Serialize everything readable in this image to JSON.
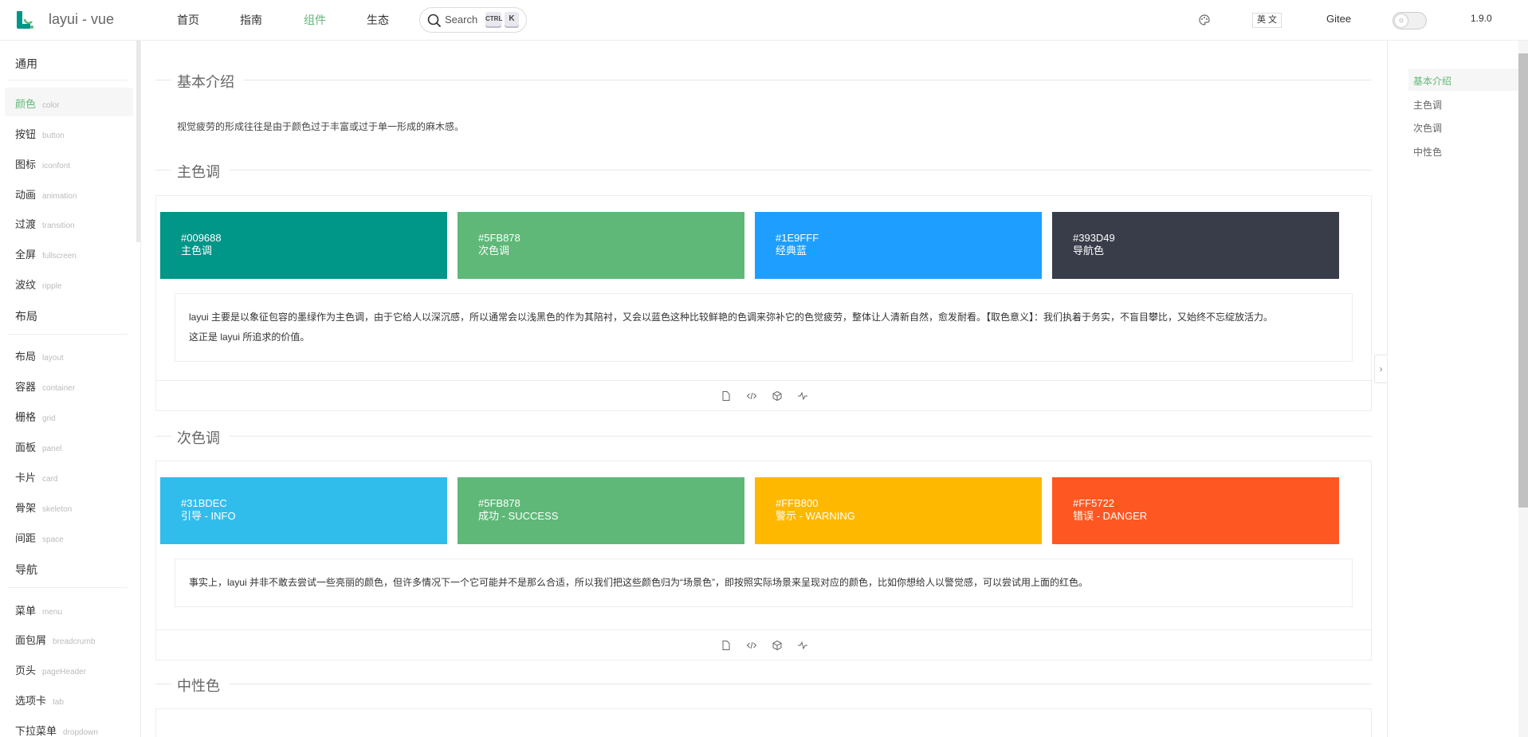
{
  "header": {
    "brand": "layui - vue",
    "nav": [
      "首页",
      "指南",
      "组件",
      "生态"
    ],
    "active_nav": "组件",
    "search_label": "Search",
    "kbd_ctrl": "CTRL",
    "kbd_k": "K",
    "lang": "英 文",
    "gitee": "Gitee",
    "version": "1.9.0"
  },
  "sidebar": {
    "sections": [
      {
        "title": "通用",
        "items": [
          {
            "cn": "颜色",
            "en": "color",
            "active": true
          },
          {
            "cn": "按钮",
            "en": "button"
          },
          {
            "cn": "图标",
            "en": "iconfont"
          },
          {
            "cn": "动画",
            "en": "animation"
          },
          {
            "cn": "过渡",
            "en": "transition"
          },
          {
            "cn": "全屏",
            "en": "fullscreen"
          },
          {
            "cn": "波纹",
            "en": "ripple"
          }
        ]
      },
      {
        "title": "布局",
        "items": [
          {
            "cn": "布局",
            "en": "layout"
          },
          {
            "cn": "容器",
            "en": "container"
          },
          {
            "cn": "栅格",
            "en": "grid"
          },
          {
            "cn": "面板",
            "en": "panel"
          },
          {
            "cn": "卡片",
            "en": "card"
          },
          {
            "cn": "骨架",
            "en": "skeleton"
          },
          {
            "cn": "间距",
            "en": "space"
          }
        ]
      },
      {
        "title": "导航",
        "items": [
          {
            "cn": "菜单",
            "en": "menu"
          },
          {
            "cn": "面包屑",
            "en": "breadcrumb"
          },
          {
            "cn": "页头",
            "en": "pageHeader"
          },
          {
            "cn": "选项卡",
            "en": "tab"
          },
          {
            "cn": "下拉菜单",
            "en": "dropdown"
          }
        ]
      }
    ]
  },
  "main": {
    "intro_title": "基本介绍",
    "intro_text": "视觉疲劳的形成往往是由于颜色过于丰富或过于单一形成的麻木感。",
    "primary": {
      "title": "主色调",
      "swatches": [
        {
          "hex": "#009688",
          "label": "主色调",
          "color": "#009688"
        },
        {
          "hex": "#5FB878",
          "label": "次色调",
          "color": "#5FB878"
        },
        {
          "hex": "#1E9FFF",
          "label": "经典蓝",
          "color": "#1E9FFF"
        },
        {
          "hex": "#393D49",
          "label": "导航色",
          "color": "#393D49"
        }
      ],
      "desc_line1": "layui 主要是以象征包容的墨绿作为主色调，由于它给人以深沉感，所以通常会以浅黑色的作为其陪衬，又会以蓝色这种比较鲜艳的色调来弥补它的色觉疲劳，整体让人清新自然，愈发耐看。【取色意义】：我们执着于务实，不盲目攀比，又始终不忘绽放活力。",
      "desc_line2": "这正是 layui 所追求的价值。"
    },
    "secondary": {
      "title": "次色调",
      "swatches": [
        {
          "hex": "#31BDEC",
          "label": "引导 - INFO",
          "color": "#31BDEC"
        },
        {
          "hex": "#5FB878",
          "label": "成功 - SUCCESS",
          "color": "#5FB878"
        },
        {
          "hex": "#FFB800",
          "label": "警示 - WARNING",
          "color": "#FFB800"
        },
        {
          "hex": "#FF5722",
          "label": "错误 - DANGER",
          "color": "#FF5722"
        }
      ],
      "desc_line1": "事实上，layui 并非不敢去尝试一些亮丽的颜色，但许多情况下一个它可能并不是那么合适，所以我们把这些颜色归为“场景色”，即按照实际场景来呈现对应的颜色，比如你想给人以警觉感，可以尝试用上面的红色。"
    },
    "neutral_title": "中性色"
  },
  "toc": {
    "items": [
      "基本介绍",
      "主色调",
      "次色调",
      "中性色"
    ],
    "active": "基本介绍"
  },
  "tool_icons": [
    "file-icon",
    "code-icon",
    "cube-icon",
    "activity-icon"
  ]
}
